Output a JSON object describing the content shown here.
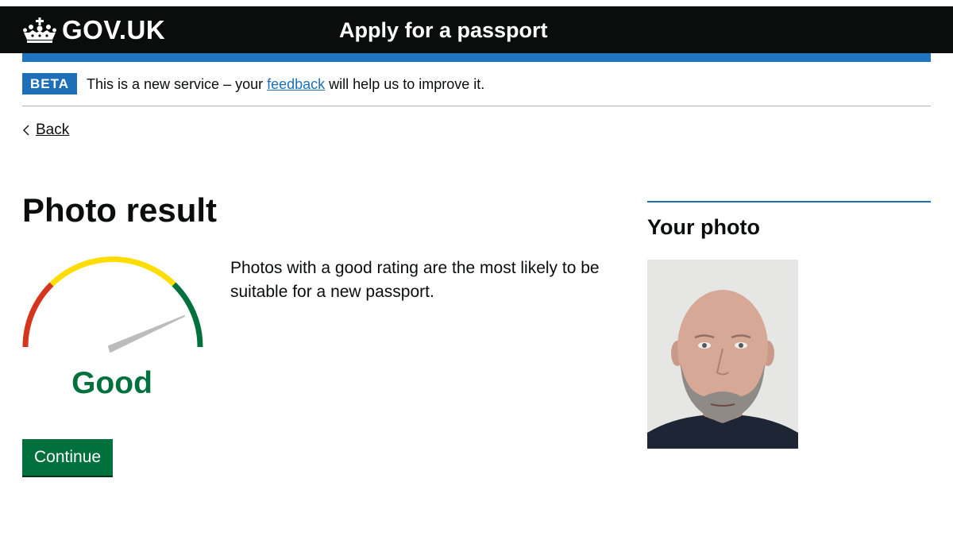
{
  "header": {
    "logo_text": "GOV.UK",
    "service_name": "Apply for a passport"
  },
  "phase_banner": {
    "tag": "BETA",
    "text_before": "This is a new service – your ",
    "link_text": "feedback",
    "text_after": " will help us to improve it."
  },
  "back_link": {
    "label": "Back"
  },
  "main": {
    "title": "Photo result",
    "rating": "Good",
    "description": "Photos with a good rating are the most likely to be suitable for a new passport.",
    "continue_label": "Continue"
  },
  "aside": {
    "title": "Your photo"
  },
  "gauge": {
    "segments": [
      "red",
      "yellow",
      "green"
    ],
    "needle_value": 0.87
  },
  "colors": {
    "header_bg": "#0b0c0c",
    "brand_blue": "#1d70b8",
    "success_green": "#00703c",
    "gauge_red": "#d4351c",
    "gauge_yellow": "#ffdd00",
    "gauge_green": "#00703c"
  },
  "icons": [
    "crown-icon",
    "chevron-left-icon"
  ]
}
